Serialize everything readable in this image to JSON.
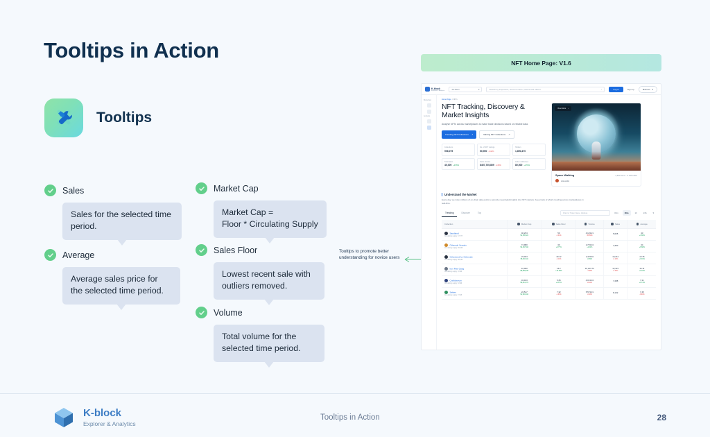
{
  "slide": {
    "title": "Tooltips in Action",
    "feature_label": "Tooltips",
    "feature_icon": "tools-icon",
    "annotation": "Tooltips to promote better understanding for novice users"
  },
  "tooltips": [
    {
      "title": "Sales",
      "body": "Sales for the selected time period."
    },
    {
      "title": "Average",
      "body": "Average sales price for the selected time period."
    },
    {
      "title": "Market Cap",
      "body": "Market Cap =\nFloor * Circulating Supply"
    },
    {
      "title": "Sales Floor",
      "body": "Lowest recent sale with outliers removed."
    },
    {
      "title": "Volume",
      "body": "Total volume for the selected time period."
    }
  ],
  "mock": {
    "banner": "NFT Home Page: V1.6",
    "topbar": {
      "brand": "K-block",
      "brand_sub": "Explorer & Analytics",
      "filter": "All filters",
      "search_placeholder": "Search by inspection, account name, tokens and tokens",
      "login": "Log in",
      "signup": "Sign up",
      "network": "Mainnet"
    },
    "sidebar": {
      "sections": [
        "Blockchain",
        "Analytics"
      ],
      "items": [
        "home-icon",
        "blocks-icon",
        "chart-icon",
        "nft-icon"
      ]
    },
    "breadcrumb_home": "Home Page",
    "breadcrumb_current": "NFTs",
    "headline": "NFT Tracking, Discovery & Market Insights",
    "subhead": "Analyse NFTs across marketplaces to make trade decisions based on reliable data.",
    "cta_primary": "Trending NFT Collections",
    "cta_secondary": "Minting NFT Collections",
    "stats": [
      {
        "label": "Collections",
        "value": "906,075",
        "delta": ""
      },
      {
        "label": "No. of NFT Listings",
        "value": "50,900",
        "delta": "-0.18%"
      },
      {
        "label": "Holders",
        "value": "1,890,470",
        "delta": ""
      },
      {
        "label": "Total Sales",
        "value": "40,000",
        "delta": "+0.55%"
      },
      {
        "label": "Sales Volume",
        "value": "$457,705,809",
        "delta": "-1.08%"
      },
      {
        "label": "Active Addresses",
        "value": "80,500",
        "delta": "+2.70%"
      }
    ],
    "hero_card": {
      "tag": "View More",
      "title": "Space Walking",
      "meta": "2,500 Items · 0.045 HIDA",
      "creator": "Arimo444"
    },
    "section": {
      "title": "Understand the Market",
      "body": "Every day, we index millions of on-chain data points to provide meaningful insights into NFT markets. Keep track of what's trending across marketplaces in real-time.",
      "tabs": [
        "Trending",
        "Discover",
        "Top"
      ],
      "active_tab": "Trending",
      "filter_placeholder": "Filter by Token Name, Address",
      "timeframes": [
        "15m",
        "30m",
        "1h",
        "24h"
      ],
      "active_timeframe": "30m"
    },
    "table": {
      "columns": [
        "Collection",
        "Market Cap",
        "Sales Floor",
        "Volume",
        "Sales",
        "Average"
      ],
      "rows": [
        {
          "name": "Sandland",
          "supply": "Circulating supply: 17,777",
          "market_cap": "40,234",
          "market_cap_sub": "$1,156,521",
          "floor": "50",
          "floor_sub": "-1.34%",
          "volume": "4,123.21",
          "volume_sub": "-58.59%",
          "sales": "5,625",
          "sales_sub": "",
          "average": "43",
          "average_sub": "+4.66%"
        },
        {
          "name": "Othersde Vessels",
          "supply": "Circulating supply: 20,000",
          "market_cap": "74,980",
          "market_cap_sub": "$2,437,844",
          "floor": "30",
          "floor_sub": "+0.77%",
          "volume": "2,733.34",
          "volume_sub": "+1.01%",
          "sales": "4,300",
          "sales_sub": "",
          "average": "34",
          "average_sub": "+6.68%"
        },
        {
          "name": "Otherdeed for Otherside",
          "supply": "Circulating supply: 98,093",
          "market_cap": "23,404",
          "market_cap_sub": "$6,043,111",
          "floor": "19.12",
          "floor_sub": "-4.11%",
          "volume": "1,423.46",
          "volume_sub": "-0.09%",
          "sales": "10,212",
          "sales_sub": "-0.14%",
          "average": "13.15",
          "average_sub": "+0.91%"
        },
        {
          "name": "Iron Paw Gang",
          "supply": "Circulating supply: 3,999",
          "market_cap": "10,000",
          "market_cap_sub": "$8,829,535",
          "floor": "14.2",
          "floor_sub": "+10.48%",
          "volume": "10,213.74",
          "volume_sub": "-7.08%",
          "sales": "12,321",
          "sales_sub": "-0.22%",
          "average": "14.11",
          "average_sub": "+0.44%"
        },
        {
          "name": "CricMuseum",
          "supply": "Circulating supply: 9,999",
          "market_cap": "34,013",
          "market_cap_sub": "$6,013,071",
          "floor": "5.25",
          "floor_sub": "+0.87%",
          "volume": "4,013.34",
          "volume_sub": "-8.04%",
          "sales": "7,288",
          "sales_sub": "",
          "average": "7.11",
          "average_sub": "+0.74%"
        },
        {
          "name": "Sekien",
          "supply": "Circulating supply: 7,545",
          "market_cap": "22,517",
          "market_cap_sub": "$1,933,044",
          "floor": "7.32",
          "floor_sub": "-1.66%",
          "volume": "5,573.31",
          "volume_sub": "-0.93%",
          "sales": "8,132",
          "sales_sub": "",
          "average": "7.45",
          "average_sub": "-3.60%"
        }
      ]
    }
  },
  "footer": {
    "brand": "K-block",
    "brand_sub": "Explorer & Analytics",
    "center": "Tooltips in Action",
    "page": "28"
  }
}
